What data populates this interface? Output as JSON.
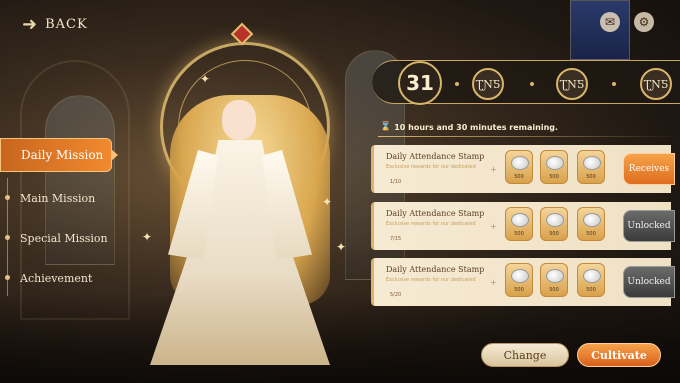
{
  "header": {
    "back_label": "BACK",
    "back_icon": "winged-arrow-icon",
    "mail_icon": "mail-icon",
    "settings_icon": "gear-icon"
  },
  "nav": {
    "items": [
      {
        "label": "Daily Mission",
        "active": true
      },
      {
        "label": "Main Mission",
        "active": false
      },
      {
        "label": "Special Mission",
        "active": false
      },
      {
        "label": "Achievement",
        "active": false
      }
    ]
  },
  "progress": {
    "current_day": "31",
    "milestones": [
      "ƮƝƼ",
      "ƮƝƼ",
      "ƮƝƼ"
    ],
    "time_remaining": "10 hours and 30 minutes remaining.",
    "time_icon": "hourglass-icon"
  },
  "missions": [
    {
      "title": "Daily Attendance Stamp",
      "subtitle": "Exclusive rewards for our dedicated",
      "progress": "1/10",
      "rewards": [
        "500",
        "500",
        "500"
      ],
      "action": "Receives",
      "action_state": "claimable"
    },
    {
      "title": "Daily Attendance Stamp",
      "subtitle": "Exclusive rewards for our dedicated",
      "progress": "7/15",
      "rewards": [
        "500",
        "500",
        "500"
      ],
      "action": "Unlocked",
      "action_state": "locked"
    },
    {
      "title": "Daily Attendance Stamp",
      "subtitle": "Exclusive rewards for our dedicated",
      "progress": "5/20",
      "rewards": [
        "500",
        "500",
        "500"
      ],
      "action": "Unlocked",
      "action_state": "locked"
    }
  ],
  "footer": {
    "change_label": "Change",
    "cultivate_label": "Cultivate"
  },
  "colors": {
    "accent_orange": "#e87a26",
    "gold": "#d9b56b",
    "card_bg": "#f6ead3",
    "locked_gray": "#4b4b4b"
  }
}
